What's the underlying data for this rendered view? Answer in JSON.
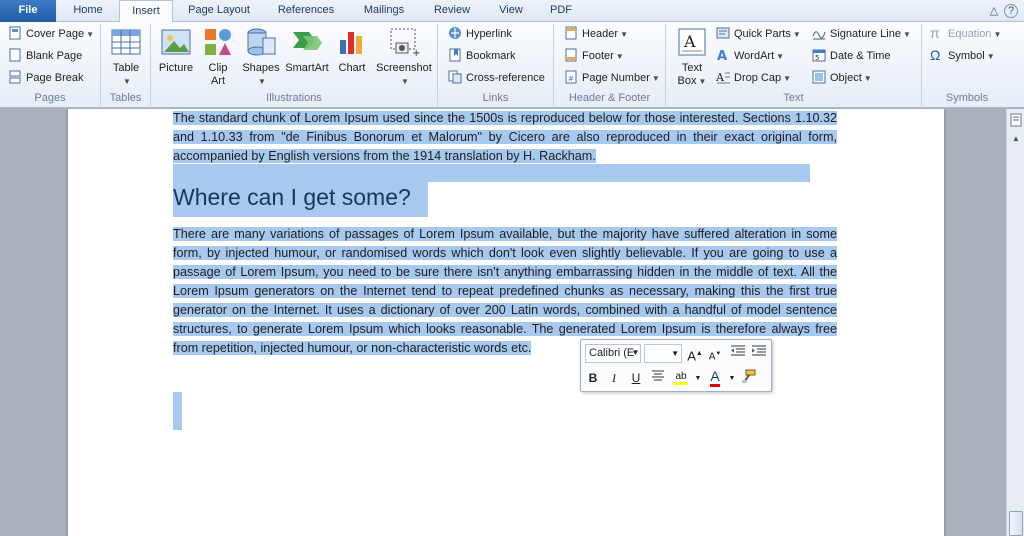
{
  "tabs": [
    "File",
    "Home",
    "Insert",
    "Page Layout",
    "References",
    "Mailings",
    "Review",
    "View",
    "PDF"
  ],
  "active_tab": "Insert",
  "window_controls": {
    "minimize": "△",
    "help": "?"
  },
  "ribbon": {
    "pages": {
      "label": "Pages",
      "cover_page": "Cover Page",
      "blank_page": "Blank Page",
      "page_break": "Page Break"
    },
    "tables": {
      "label": "Tables",
      "table": "Table"
    },
    "illustrations": {
      "label": "Illustrations",
      "picture": "Picture",
      "clip_art_1": "Clip",
      "clip_art_2": "Art",
      "shapes": "Shapes",
      "smartart": "SmartArt",
      "chart": "Chart",
      "screenshot": "Screenshot"
    },
    "links": {
      "label": "Links",
      "hyperlink": "Hyperlink",
      "bookmark": "Bookmark",
      "cross_reference": "Cross-reference"
    },
    "header_footer": {
      "label": "Header & Footer",
      "header": "Header",
      "footer": "Footer",
      "page_number": "Page Number"
    },
    "text": {
      "label": "Text",
      "text_box_1": "Text",
      "text_box_2": "Box",
      "quick_parts": "Quick Parts",
      "wordart": "WordArt",
      "drop_cap": "Drop Cap",
      "signature_line": "Signature Line",
      "date_time": "Date & Time",
      "object": "Object"
    },
    "symbols": {
      "label": "Symbols",
      "equation": "Equation",
      "symbol": "Symbol"
    }
  },
  "document": {
    "para1": "The standard chunk of Lorem Ipsum used since the 1500s is reproduced below for those interested. Sections 1.10.32 and 1.10.33 from \"de Finibus Bonorum et Malorum\" by Cicero are also reproduced in their exact original form, accompanied by English versions from the 1914 translation by H. Rackham.",
    "heading": "Where can I get some?",
    "para2": "There are many variations of passages of Lorem Ipsum available, but the majority have suffered alteration in some form, by injected humour, or randomised words which don't look even slightly believable. If you are going to use a passage of Lorem Ipsum, you need to be sure there isn't anything embarrassing hidden in the middle of text. All the Lorem Ipsum generators on the Internet tend to repeat predefined chunks as necessary, making this the first true generator on the Internet. It uses a dictionary of over 200 Latin words, combined with a handful of model sentence structures, to generate Lorem Ipsum which looks reasonable. The generated Lorem Ipsum is therefore always free from repetition, injected humour, or non-characteristic words etc."
  },
  "mini_toolbar": {
    "font": "Calibri (E",
    "size": "",
    "grow": "A",
    "shrink": "A",
    "bold": "B",
    "italic": "I",
    "underline": "U",
    "highlight": "ab",
    "font_color": "A"
  },
  "colors": {
    "selection": "#a8c9ef",
    "heading": "#17365d",
    "highlight_yellow": "#ffff00",
    "font_red": "#e00000"
  }
}
